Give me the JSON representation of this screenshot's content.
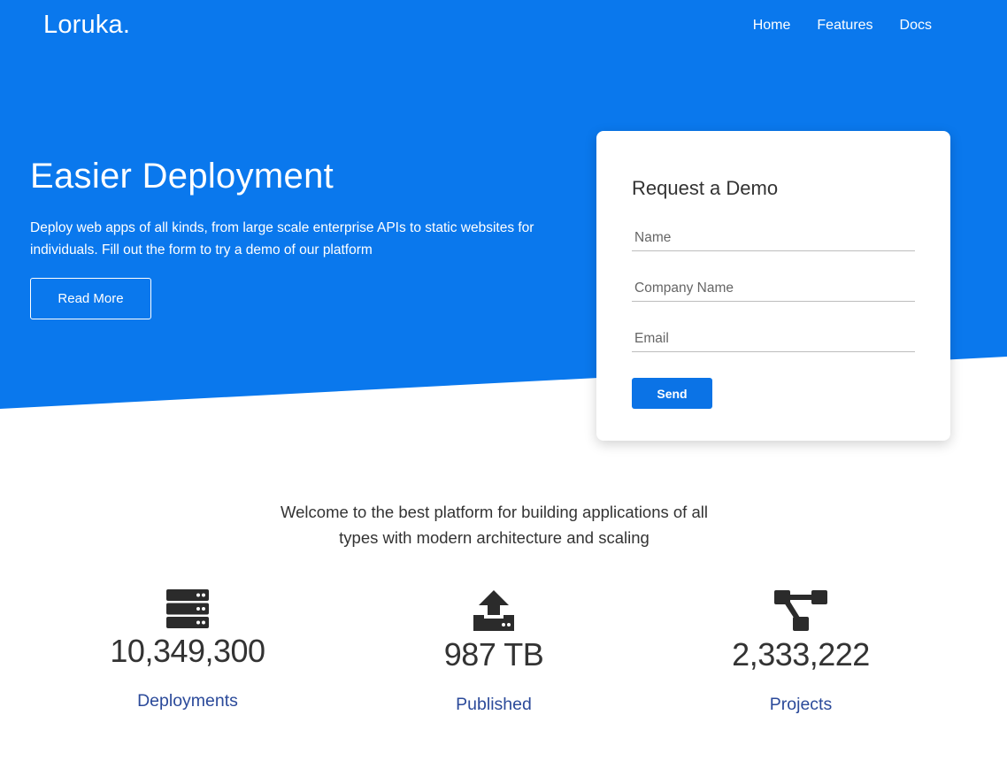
{
  "colors": {
    "primary": "#0a78ed",
    "button": "#0b73e6",
    "stat_label": "#2b4a9a",
    "text": "#333333"
  },
  "brand": "Loruka.",
  "nav": [
    {
      "label": "Home"
    },
    {
      "label": "Features"
    },
    {
      "label": "Docs"
    }
  ],
  "hero": {
    "title": "Easier Deployment",
    "text": "Deploy web apps of all kinds, from large scale enterprise APIs to static websites for individuals. Fill out the form to try a demo of our platform",
    "button_label": "Read More"
  },
  "demo_form": {
    "title": "Request a Demo",
    "fields": [
      {
        "placeholder": "Name"
      },
      {
        "placeholder": "Company Name"
      },
      {
        "placeholder": "Email"
      }
    ],
    "send_label": "Send"
  },
  "welcome": {
    "line1": "Welcome to the best platform for building applications of all",
    "line2": "types with modern architecture and scaling"
  },
  "stats": [
    {
      "icon": "server-icon",
      "number": "10,349,300",
      "label": "Deployments"
    },
    {
      "icon": "upload-icon",
      "number": "987 TB",
      "label": "Published"
    },
    {
      "icon": "project-diagram-icon",
      "number": "2,333,222",
      "label": "Projects"
    }
  ]
}
